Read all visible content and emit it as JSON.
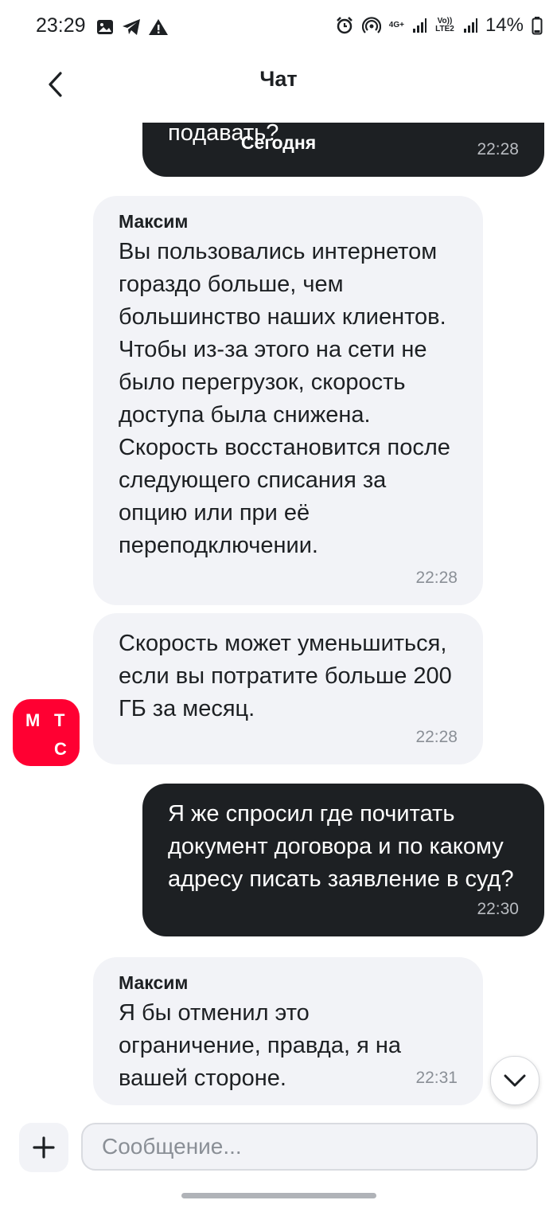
{
  "status_bar": {
    "time": "23:29",
    "network_4g": "4G+",
    "volte": "Vo)) LTE2",
    "battery": "14%"
  },
  "header": {
    "title": "Чат"
  },
  "date_separator": "Сегодня",
  "messages": [
    {
      "direction": "outgoing",
      "text": "и по какому адресу в суд подавать?",
      "time": "22:28"
    },
    {
      "direction": "incoming",
      "sender": "Максим",
      "text": "Вы пользовались интернетом гораздо больше, чем большинство наших клиентов. Чтобы из-за этого на сети не было перегрузок, скорость доступа была снижена. Скорость восстановится после следующего списания за опцию или при её переподключении.",
      "time": "22:28"
    },
    {
      "direction": "incoming",
      "text": "Скорость может уменьшиться, если вы потратите больше 200 ГБ за месяц.",
      "time": "22:28"
    },
    {
      "direction": "outgoing",
      "text": "Я же спросил где почитать документ договора и по какому адресу писать заявление в суд?",
      "time": "22:30"
    },
    {
      "direction": "incoming",
      "sender": "Максим",
      "text": "Я бы отменил это ограничение, правда, я на вашей стороне.",
      "time": "22:31"
    }
  ],
  "avatar": {
    "letters": [
      "М",
      "Т",
      "С"
    ],
    "color": "#ff0032"
  },
  "composer": {
    "placeholder": "Сообщение..."
  },
  "colors": {
    "outgoing_bubble": "#1d2023",
    "incoming_bubble": "#f2f3f7",
    "brand": "#ff0032"
  }
}
